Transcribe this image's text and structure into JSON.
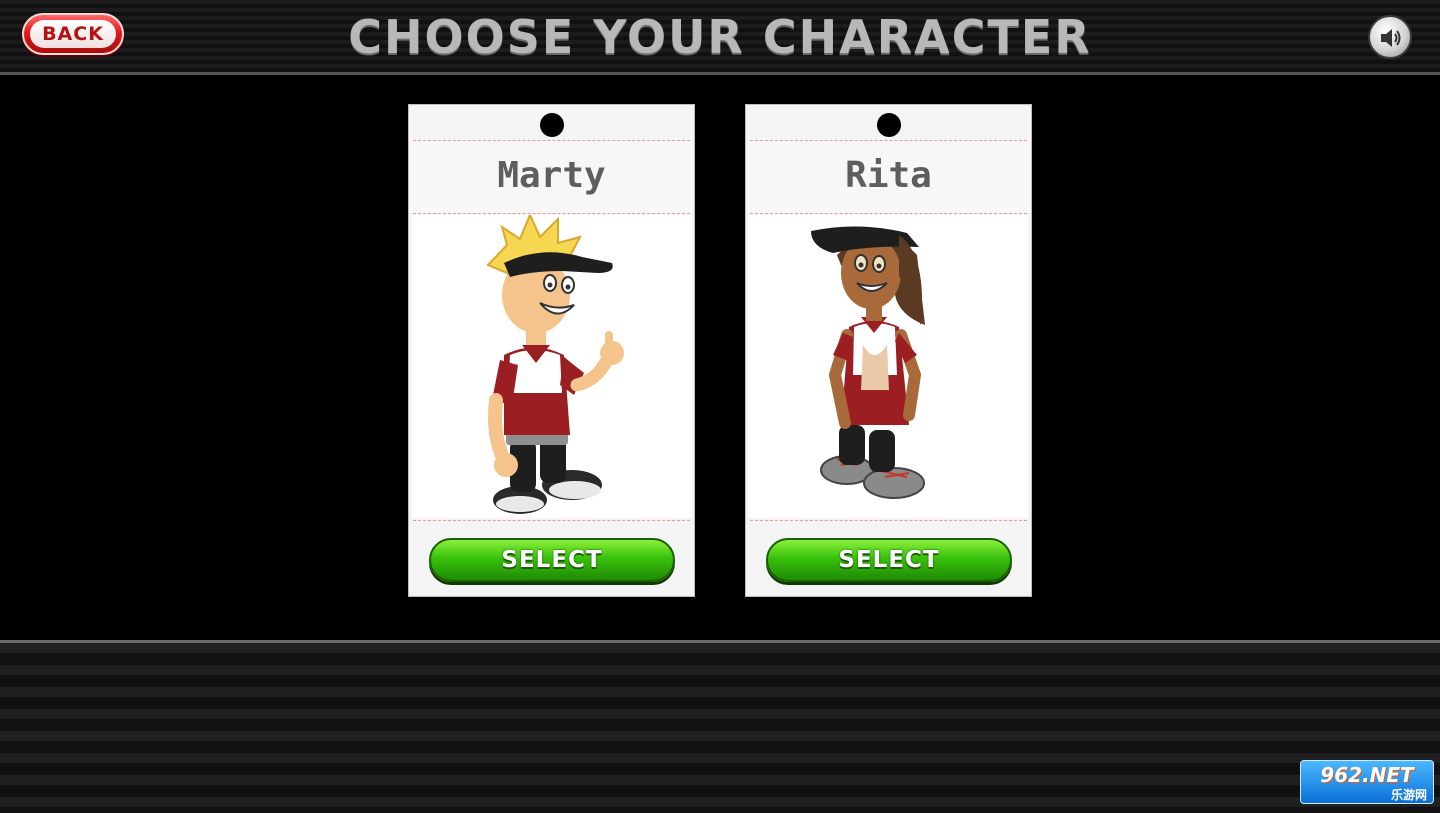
{
  "header": {
    "back_label": "BACK",
    "title": "CHOOSE YOUR CHARACTER",
    "sound_icon": "speaker-icon"
  },
  "characters": [
    {
      "name": "Marty",
      "select_label": "SELECT",
      "portrait_icon": "marty-character-illustration"
    },
    {
      "name": "Rita",
      "select_label": "SELECT",
      "portrait_icon": "rita-character-illustration"
    }
  ],
  "watermark": {
    "top": "962.NET",
    "bottom": "乐游网"
  },
  "colors": {
    "back_red": "#e01b1b",
    "select_green": "#39c10c",
    "title_gray": "#b8b8b8",
    "uniform_maroon": "#9b1f22"
  }
}
